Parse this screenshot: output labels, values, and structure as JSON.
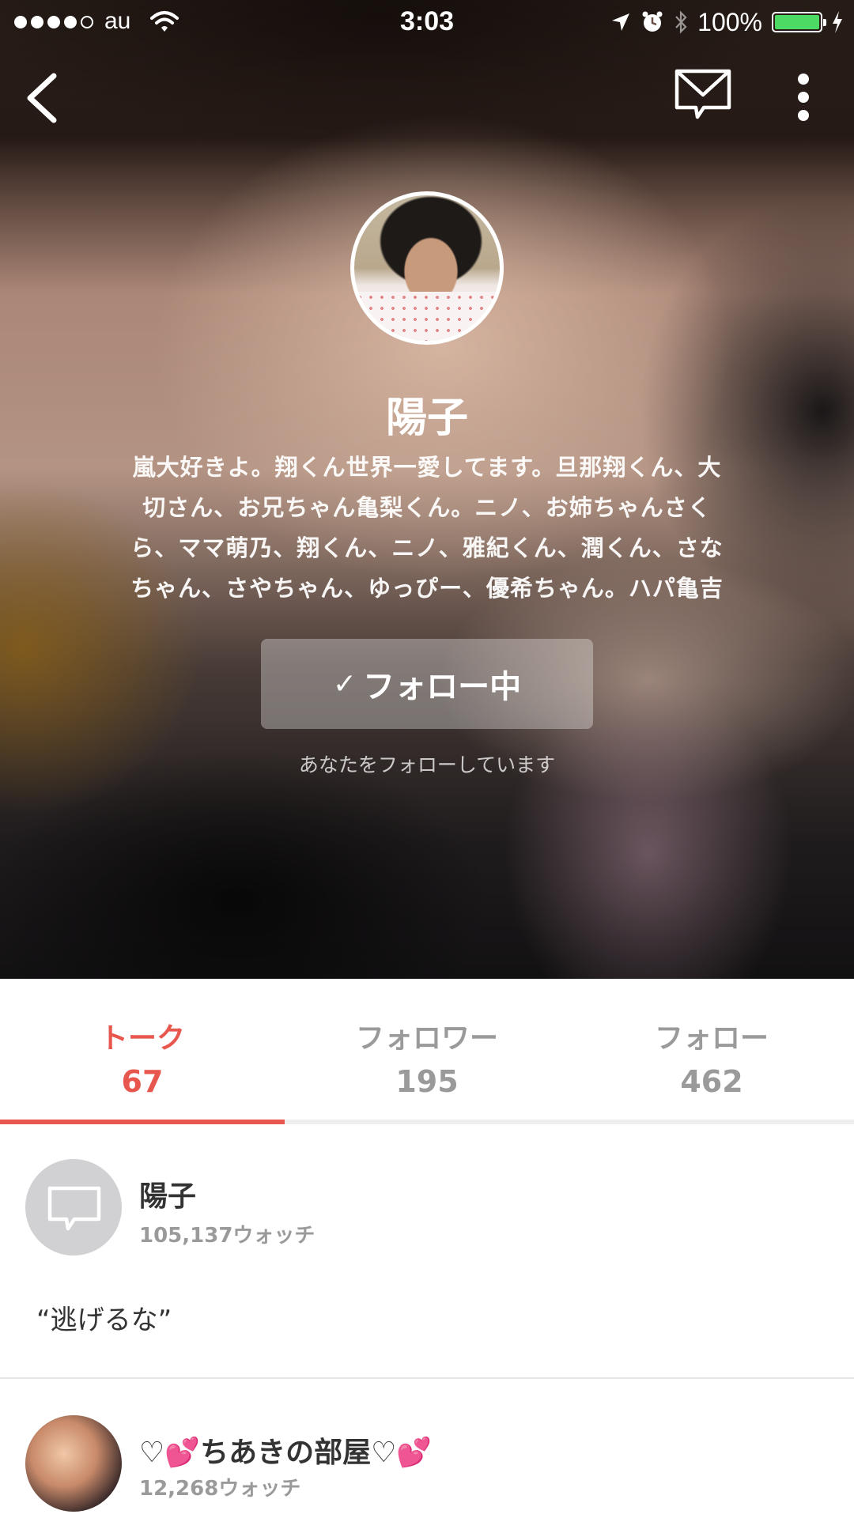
{
  "status_bar": {
    "carrier": "au",
    "time": "3:03",
    "battery_percent": "100%",
    "battery_level": 1.0,
    "signal_bars_filled": 4,
    "signal_bars_total": 5
  },
  "colors": {
    "accent": "#e8574e",
    "battery_green": "#4cd964",
    "inactive_text": "#9a9a9a"
  },
  "nav": {
    "back_icon": "chevron-left-icon",
    "message_icon": "envelope-icon",
    "more_icon": "vertical-ellipsis-icon"
  },
  "profile": {
    "name": "陽子",
    "bio_lines": [
      "嵐大好きよ。翔くん世界一愛してます。旦那翔くん、大",
      "切さん、お兄ちゃん亀梨くん。ニノ、お姉ちゃんさく",
      "ら、ママ萌乃、翔くん、ニノ、雅紀くん、潤くん、さな",
      "ちゃん、さやちゃん、ゆっぴー、優希ちゃん。ハパ亀吉"
    ],
    "follow_button_check": "✓",
    "follow_button_label": "フォロー中",
    "follows_you_text": "あなたをフォローしています"
  },
  "tabs": [
    {
      "label": "トーク",
      "count": "67",
      "active": true
    },
    {
      "label": "フォロワー",
      "count": "195",
      "active": false
    },
    {
      "label": "フォロー",
      "count": "462",
      "active": false
    }
  ],
  "talks": [
    {
      "title": "陽子",
      "watch_count": "105,137ウォッチ",
      "latest_message": "“逃げるな”"
    },
    {
      "title": "♡💕ちあきの部屋♡💕",
      "watch_count": "12,268ウォッチ"
    }
  ]
}
